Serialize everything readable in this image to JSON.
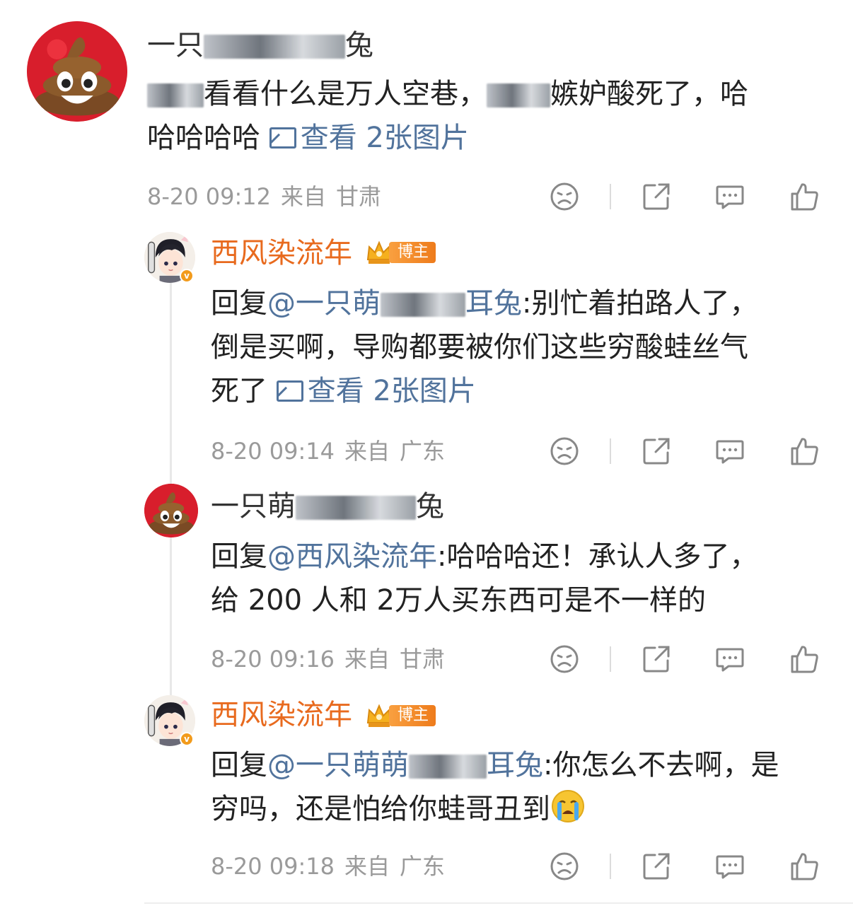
{
  "comments": [
    {
      "id": "c1",
      "name_prefix": "一只",
      "name_suffix": "兔",
      "is_blogger": false,
      "text_lines": [
        "看看什么是万人空巷，",
        "嫉妒酸死了，哈",
        "哈哈哈哈"
      ],
      "image_link": "查看 2张图片",
      "time": "8-20 09:12",
      "from": "来自",
      "location": "甘肃"
    },
    {
      "id": "c2",
      "name": "西风染流年",
      "is_blogger": true,
      "badge": "博主",
      "reply_prefix": "回复",
      "mention_prefix": "@一只萌",
      "mention_suffix": "耳兔",
      "text_after": ":别忙着拍路人了，",
      "text_line2": "倒是买啊，导购都要被你们这些穷酸蛙丝气",
      "text_line3": "死了",
      "image_link": "查看 2张图片",
      "time": "8-20 09:14",
      "from": "来自",
      "location": "广东"
    },
    {
      "id": "c3",
      "name_prefix": "一只萌",
      "name_suffix": "兔",
      "is_blogger": false,
      "reply_prefix": "回复",
      "mention": "@西风染流年",
      "text_after": ":哈哈哈还！承认人多了，",
      "text_line2": "给 200 人和 2万人买东西可是不一样的",
      "time": "8-20 09:16",
      "from": "来自",
      "location": "甘肃"
    },
    {
      "id": "c4",
      "name": "西风染流年",
      "is_blogger": true,
      "badge": "博主",
      "reply_prefix": "回复",
      "mention_prefix": "@一只萌萌",
      "mention_suffix": "耳兔",
      "text_after": ":你怎么不去啊，是",
      "text_line2": "穷吗，还是怕给你蛙哥丑到",
      "time": "8-20 09:18",
      "from": "来自",
      "location": "广东"
    }
  ],
  "icons": [
    "dislike-face-icon",
    "share-icon",
    "comment-icon",
    "like-thumb-icon"
  ],
  "colors": {
    "blogger_name": "#e86a1e",
    "link": "#51739c",
    "meta": "#9a9a9a"
  }
}
